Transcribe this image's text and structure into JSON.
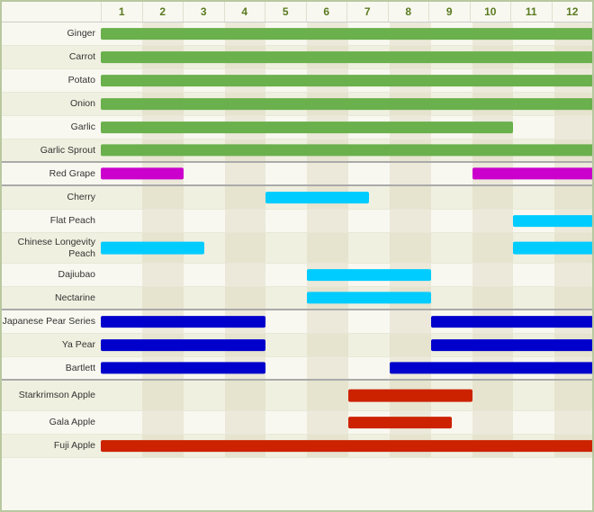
{
  "months": [
    "1",
    "2",
    "3",
    "4",
    "5",
    "6",
    "7",
    "8",
    "9",
    "10",
    "11",
    "12"
  ],
  "rows": [
    {
      "label": "Ginger",
      "bars": [
        {
          "start": 1,
          "end": 12,
          "color": "#6ab04c"
        }
      ],
      "group": "veg",
      "height": "normal"
    },
    {
      "label": "Carrot",
      "bars": [
        {
          "start": 1,
          "end": 12,
          "color": "#6ab04c"
        }
      ],
      "group": "veg",
      "height": "normal"
    },
    {
      "label": "Potato",
      "bars": [
        {
          "start": 1,
          "end": 12,
          "color": "#6ab04c"
        }
      ],
      "group": "veg",
      "height": "normal"
    },
    {
      "label": "Onion",
      "bars": [
        {
          "start": 1,
          "end": 12,
          "color": "#6ab04c"
        }
      ],
      "group": "veg",
      "height": "normal"
    },
    {
      "label": "Garlic",
      "bars": [
        {
          "start": 1,
          "end": 10,
          "color": "#6ab04c"
        }
      ],
      "group": "veg",
      "height": "normal"
    },
    {
      "label": "Garlic Sprout",
      "bars": [
        {
          "start": 1,
          "end": 12,
          "color": "#6ab04c"
        }
      ],
      "group": "veg",
      "height": "normal",
      "divider_after": true
    },
    {
      "label": "Red Grape",
      "bars": [
        {
          "start": 1,
          "end": 2,
          "color": "#cc00cc"
        },
        {
          "start": 10,
          "end": 12,
          "color": "#cc00cc"
        }
      ],
      "group": "grape",
      "height": "normal",
      "divider_after": true
    },
    {
      "label": "Cherry",
      "bars": [
        {
          "start": 5,
          "end": 6.5,
          "color": "#00ccff"
        }
      ],
      "group": "fruit1",
      "height": "normal"
    },
    {
      "label": "Flat Peach",
      "bars": [
        {
          "start": 11,
          "end": 12,
          "color": "#00ccff"
        }
      ],
      "group": "fruit1",
      "height": "normal"
    },
    {
      "label": "Chinese Longevity Peach",
      "bars": [
        {
          "start": 1,
          "end": 2.5,
          "color": "#00ccff"
        },
        {
          "start": 11,
          "end": 12,
          "color": "#00ccff"
        }
      ],
      "group": "fruit1",
      "height": "tall"
    },
    {
      "label": "Dajiubao",
      "bars": [
        {
          "start": 6,
          "end": 8,
          "color": "#00ccff"
        }
      ],
      "group": "fruit1",
      "height": "normal"
    },
    {
      "label": "Nectarine",
      "bars": [
        {
          "start": 6,
          "end": 8,
          "color": "#00ccff"
        }
      ],
      "group": "fruit1",
      "height": "normal",
      "divider_after": true
    },
    {
      "label": "Japanese Pear Series",
      "bars": [
        {
          "start": 1,
          "end": 4,
          "color": "#0000cc"
        },
        {
          "start": 9,
          "end": 12,
          "color": "#0000cc"
        }
      ],
      "group": "pear",
      "height": "normal"
    },
    {
      "label": "Ya Pear",
      "bars": [
        {
          "start": 1,
          "end": 4,
          "color": "#0000cc"
        },
        {
          "start": 9,
          "end": 12,
          "color": "#0000cc"
        }
      ],
      "group": "pear",
      "height": "normal"
    },
    {
      "label": "Bartlett",
      "bars": [
        {
          "start": 1,
          "end": 4,
          "color": "#0000cc"
        },
        {
          "start": 8,
          "end": 12,
          "color": "#0000cc"
        }
      ],
      "group": "pear",
      "height": "normal",
      "divider_after": true
    },
    {
      "label": "Starkrimson Apple",
      "bars": [
        {
          "start": 7,
          "end": 9,
          "color": "#cc2200"
        }
      ],
      "group": "apple",
      "height": "tall"
    },
    {
      "label": "Gala Apple",
      "bars": [
        {
          "start": 7,
          "end": 8.5,
          "color": "#cc2200"
        }
      ],
      "group": "apple",
      "height": "normal"
    },
    {
      "label": "Fuji Apple",
      "bars": [
        {
          "start": 1,
          "end": 12,
          "color": "#cc2200"
        }
      ],
      "group": "apple",
      "height": "normal"
    }
  ],
  "colors": {
    "bg_odd": "#f8f8f0",
    "bg_even": "#f0f0e0",
    "col_shade": "rgba(220,210,180,0.35)",
    "border": "#b8c8a0"
  }
}
